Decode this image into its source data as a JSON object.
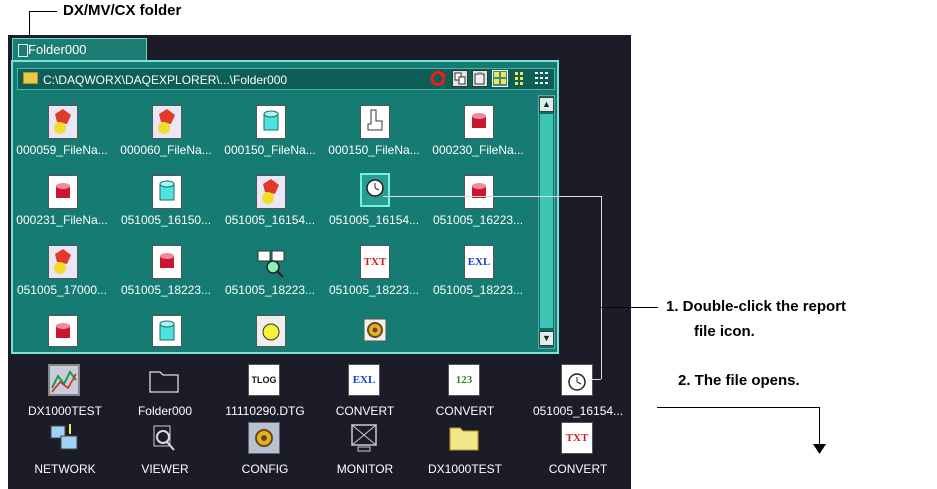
{
  "callouts": {
    "folder_label": "DX/MV/CX folder",
    "step1_line1": "1.  Double-click the report",
    "step1_line2": "file icon.",
    "step2": "2.  The file opens."
  },
  "tab": {
    "label": "Folder000"
  },
  "pathbar": {
    "path": "C:\\DAQWORX\\DAQEXPLORER\\...\\Folder000"
  },
  "files": [
    {
      "label": "000059_FileNa...",
      "icon": "alarm-file-icon"
    },
    {
      "label": "000060_FileNa...",
      "icon": "alarm-file-icon"
    },
    {
      "label": "000150_FileNa...",
      "icon": "cylinder-file-icon"
    },
    {
      "label": "000150_FileNa...",
      "icon": "hand-file-icon"
    },
    {
      "label": "000230_FileNa...",
      "icon": "red-cylinder-file-icon"
    },
    {
      "label": "000231_FileNa...",
      "icon": "red-cylinder-file-icon"
    },
    {
      "label": "051005_16150...",
      "icon": "cylinder-file-icon"
    },
    {
      "label": "051005_16154...",
      "icon": "alarm-file-icon"
    },
    {
      "label": "051005_16154...",
      "icon": "report-clock-file-icon"
    },
    {
      "label": "051005_16223...",
      "icon": "red-cylinder-file-icon"
    },
    {
      "label": "051005_17000...",
      "icon": "alarm-file-icon"
    },
    {
      "label": "051005_18223...",
      "icon": "red-cylinder-file-icon"
    },
    {
      "label": "051005_18223...",
      "icon": "search-file-icon"
    },
    {
      "label": "051005_18223...",
      "icon": "txt-file-icon"
    },
    {
      "label": "051005_18223...",
      "icon": "exl-file-icon"
    },
    {
      "label": "",
      "icon": "red-cylinder-file-icon"
    },
    {
      "label": "",
      "icon": "cylinder-file-icon"
    },
    {
      "label": "",
      "icon": "yellow-circle-file-icon"
    },
    {
      "label": "",
      "icon": "gear-file-icon"
    }
  ],
  "desktop": [
    {
      "label": "DX1000TEST",
      "icon": "chart-recorder-icon"
    },
    {
      "label": "Folder000",
      "icon": "folder-outline-icon"
    },
    {
      "label": "11110290.DTG",
      "icon": "tlog-file-icon"
    },
    {
      "label": "CONVERT",
      "icon": "exl-convert-icon"
    },
    {
      "label": "CONVERT",
      "icon": "123-convert-icon"
    },
    {
      "label": "051005_16154...",
      "icon": "report-clock-icon"
    },
    {
      "label": "NETWORK",
      "icon": "network-icon"
    },
    {
      "label": "VIEWER",
      "icon": "viewer-icon"
    },
    {
      "label": "CONFIG",
      "icon": "config-icon"
    },
    {
      "label": "MONITOR",
      "icon": "monitor-icon"
    },
    {
      "label": "DX1000TEST",
      "icon": "yellow-folder-icon"
    },
    {
      "label": "CONVERT",
      "icon": "txt-convert-icon"
    }
  ],
  "glyphs": {
    "txt": "TXT",
    "exl": "EXL",
    "tlog": "TLOG",
    "n123": "123",
    "up": "▲",
    "down": "▼"
  }
}
